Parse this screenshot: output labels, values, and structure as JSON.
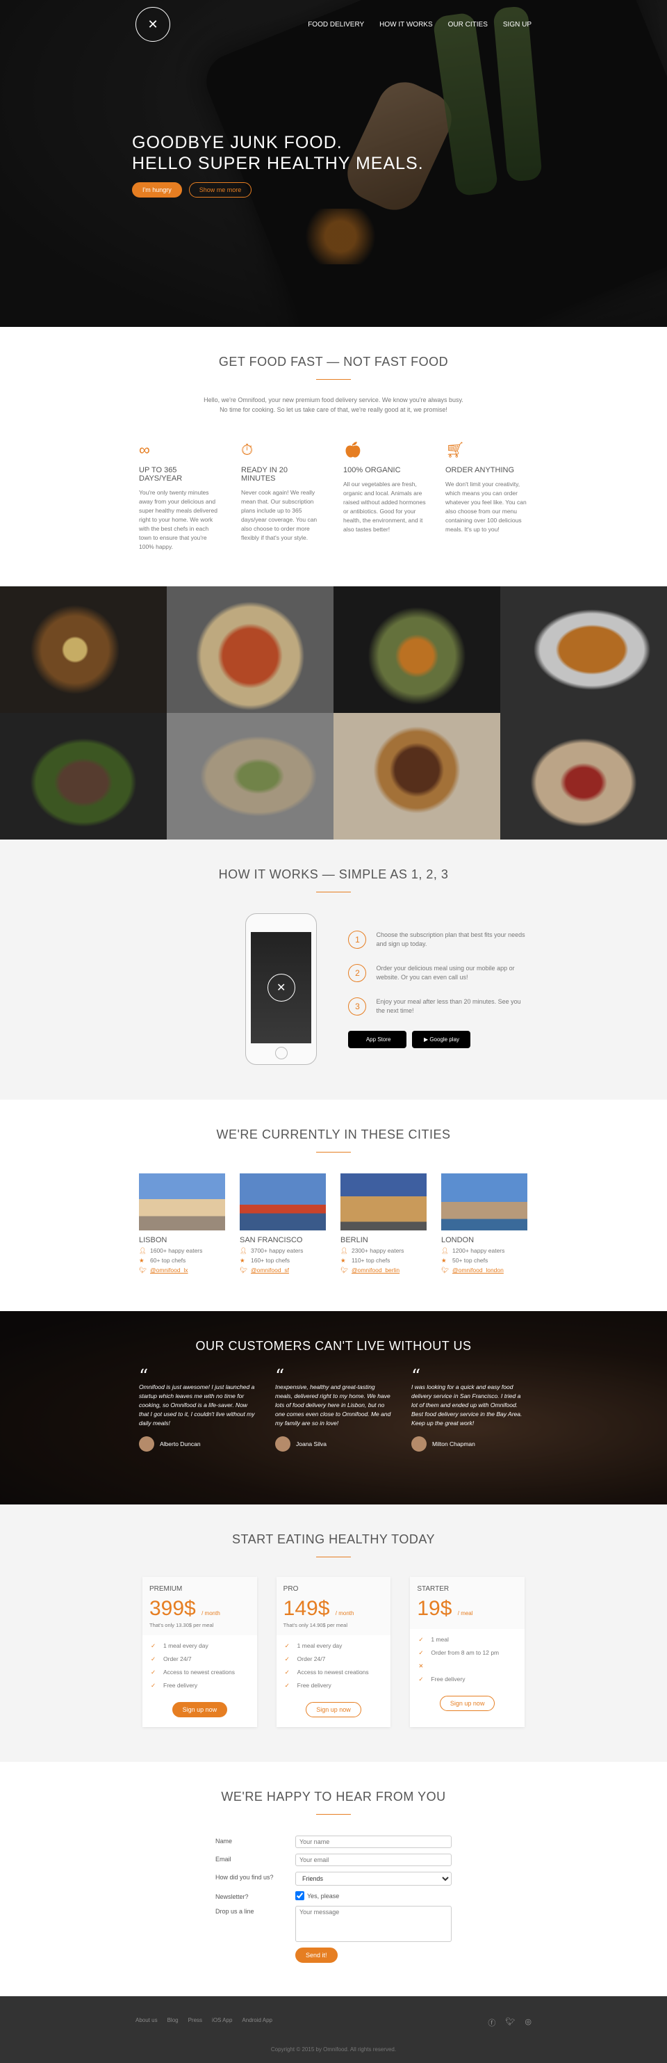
{
  "nav": {
    "logo_icon": "fork-knife-icon",
    "items": [
      "Food delivery",
      "How it works",
      "Our cities",
      "Sign up"
    ]
  },
  "hero": {
    "line1": "Goodbye junk food.",
    "line2": "Hello super healthy meals.",
    "btn_primary": "I'm hungry",
    "btn_secondary": "Show me more"
  },
  "features": {
    "title": "Get food fast — not fast food",
    "intro": "Hello, we're Omnifood, your new premium food delivery service. We know you're always busy. No time for cooking. So let us take care of that, we're really good at it, we promise!",
    "items": [
      {
        "icon": "infinity-icon",
        "title": "Up to 365 days/year",
        "text": "You're only twenty minutes away from your delicious and super healthy meals delivered right to your home. We work with the best chefs in each town to ensure that you're 100% happy."
      },
      {
        "icon": "stopwatch-icon",
        "title": "Ready in 20 minutes",
        "text": "Never cook again! We really mean that. Our subscription plans include up to 365 days/year coverage. You can also choose to order more flexibly if that's your style."
      },
      {
        "icon": "apple-icon",
        "title": "100% organic",
        "text": "All our vegetables are fresh, organic and local. Animals are raised without added hormones or antibiotics. Good for your health, the environment, and it also tastes better!"
      },
      {
        "icon": "cart-icon",
        "title": "Order anything",
        "text": "We don't limit your creativity, which means you can order whatever you feel like. You can also choose from our menu containing over 100 delicious meals. It's up to you!"
      }
    ]
  },
  "how": {
    "title": "How it works — Simple as 1, 2, 3",
    "steps": [
      {
        "num": "1",
        "text": "Choose the subscription plan that best fits your needs and sign up today."
      },
      {
        "num": "2",
        "text": "Order your delicious meal using our mobile app or website. Or you can even call us!"
      },
      {
        "num": "3",
        "text": "Enjoy your meal after less than 20 minutes. See you the next time!"
      }
    ],
    "app_store": "App Store",
    "google_play": "Google play"
  },
  "cities": {
    "title": "We're currently in these cities",
    "items": [
      {
        "name": "Lisbon",
        "eaters": "1600+ happy eaters",
        "chefs": "60+ top chefs",
        "twitter": "@omnifood_lx"
      },
      {
        "name": "San Francisco",
        "eaters": "3700+ happy eaters",
        "chefs": "160+ top chefs",
        "twitter": "@omnifood_sf"
      },
      {
        "name": "Berlin",
        "eaters": "2300+ happy eaters",
        "chefs": "110+ top chefs",
        "twitter": "@omnifood_berlin"
      },
      {
        "name": "London",
        "eaters": "1200+ happy eaters",
        "chefs": "50+ top chefs",
        "twitter": "@omnifood_london"
      }
    ]
  },
  "testimonials": {
    "title": "Our customers can't live without us",
    "items": [
      {
        "text": "Omnifood is just awesome! I just launched a startup which leaves me with no time for cooking, so Omnifood is a life-saver. Now that I got used to it, I couldn't live without my daily meals!",
        "name": "Alberto Duncan"
      },
      {
        "text": "Inexpensive, healthy and great-tasting meals, delivered right to my home. We have lots of food delivery here in Lisbon, but no one comes even close to Omnifood. Me and my family are so in love!",
        "name": "Joana Silva"
      },
      {
        "text": "I was looking for a quick and easy food delivery service in San Francisco. I tried a lot of them and ended up with Omnifood. Best food delivery service in the Bay Area. Keep up the great work!",
        "name": "Milton Chapman"
      }
    ]
  },
  "plans": {
    "title": "Start eating healthy today",
    "items": [
      {
        "name": "Premium",
        "price": "399$",
        "period": "/ month",
        "sub": "That's only 13.30$ per meal",
        "features": [
          "1 meal every day",
          "Order 24/7",
          "Access to newest creations",
          "Free delivery"
        ],
        "cta": "Sign up now",
        "style": "full"
      },
      {
        "name": "Pro",
        "price": "149$",
        "period": "/ month",
        "sub": "That's only 14.90$ per meal",
        "features": [
          "1 meal every day",
          "Order 24/7",
          "Access to newest creations",
          "Free delivery"
        ],
        "cta": "Sign up now",
        "style": "ghost"
      },
      {
        "name": "Starter",
        "price": "19$",
        "period": "/ meal",
        "sub": "",
        "features": [
          "1 meal",
          "Order from 8 am to 12 pm",
          "",
          "Free delivery"
        ],
        "cta": "Sign up now",
        "style": "ghost"
      }
    ]
  },
  "contact": {
    "title": "We're happy to hear from you",
    "name_label": "Name",
    "name_placeholder": "Your name",
    "email_label": "Email",
    "email_placeholder": "Your email",
    "find_label": "How did you find us?",
    "find_value": "Friends",
    "news_label": "Newsletter?",
    "news_check": "Yes, please",
    "msg_label": "Drop us a line",
    "msg_placeholder": "Your message",
    "submit": "Send it!"
  },
  "footer": {
    "links": [
      "About us",
      "Blog",
      "Press",
      "iOS App",
      "Android App"
    ],
    "social": [
      "facebook-icon",
      "twitter-icon",
      "instagram-icon"
    ],
    "copyright": "Copyright © 2015 by Omnifood. All rights reserved."
  },
  "colors": {
    "accent": "#e67e22",
    "footer": "#333333"
  }
}
